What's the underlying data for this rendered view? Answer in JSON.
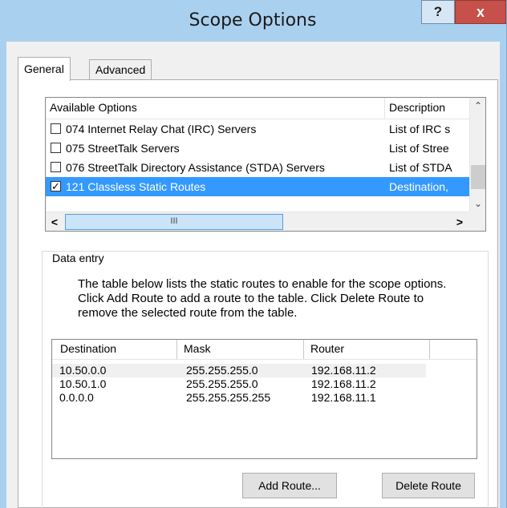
{
  "window": {
    "title": "Scope Options",
    "help_label": "?",
    "close_label": "x"
  },
  "tabs": [
    {
      "label": "General",
      "active": true
    },
    {
      "label": "Advanced",
      "active": false
    }
  ],
  "options_list": {
    "headers": [
      "Available Options",
      "Description"
    ],
    "rows": [
      {
        "checked": false,
        "name": "074 Internet Relay Chat (IRC) Servers",
        "description": "List of IRC s",
        "selected": false
      },
      {
        "checked": false,
        "name": "075 StreetTalk Servers",
        "description": "List of Stree",
        "selected": false
      },
      {
        "checked": false,
        "name": "076 StreetTalk Directory Assistance (STDA) Servers",
        "description": "List of STDA",
        "selected": false
      },
      {
        "checked": true,
        "name": "121 Classless Static Routes",
        "description": "Destination,",
        "selected": true
      }
    ],
    "scroll_up": "^",
    "scroll_down": "v",
    "scroll_left": "<",
    "scroll_right": ">",
    "hthumb_grip": "III"
  },
  "data_entry": {
    "label": "Data entry",
    "description": "The table below lists the static routes to enable for the scope options.  Click Add Route to add a route to the table.  Click Delete Route to remove the selected route from the table.",
    "columns": [
      "Destination",
      "Mask",
      "Router"
    ],
    "routes": [
      {
        "destination": "10.50.0.0",
        "mask": "255.255.255.0",
        "router": "192.168.11.2"
      },
      {
        "destination": "10.50.1.0",
        "mask": "255.255.255.0",
        "router": "192.168.11.2"
      },
      {
        "destination": "0.0.0.0",
        "mask": "255.255.255.255",
        "router": "192.168.11.1"
      }
    ],
    "add_route_label": "Add Route...",
    "delete_route_label": "Delete Route"
  },
  "colors": {
    "titlebar": "#aad0ef",
    "selection": "#3399ff",
    "close": "#c7504a"
  }
}
